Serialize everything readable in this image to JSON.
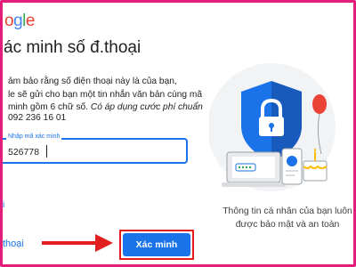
{
  "header": {
    "logo_letters": [
      "o",
      "g",
      "l",
      "e"
    ],
    "logo_colors": [
      "#ea4335",
      "#4285f4",
      "#34a853",
      "#ea4335"
    ]
  },
  "main": {
    "title": "ác minh số đ.thoại",
    "desc_line1": "ảm bảo rằng số điện thoại này là của bạn,",
    "desc_line2": "le sẽ gửi cho bạn một tin nhắn văn bản cùng mã",
    "desc_line3_plain": "minh gồm 6 chữ số. ",
    "desc_line3_italic": "Có áp dụng cước phí chuẩn",
    "phone": "092 236 16 01",
    "field_label": "Nhập mã xác minh",
    "field_value": "526778",
    "small_link": "i",
    "back_link": "thoại",
    "verify_button": "Xác minh"
  },
  "illustration": {
    "caption_line1": "Thông tin cá nhân của bạn luôn",
    "caption_line2": "được bảo mật và an toàn"
  },
  "colors": {
    "accent": "#1a73e8",
    "frame": "#e31e7a",
    "arrow": "#e31e1e"
  },
  "icons": [
    "shield-lock-icon",
    "laptop-icon",
    "phone-icon",
    "cake-icon",
    "balloon-icon",
    "red-arrow-icon"
  ]
}
